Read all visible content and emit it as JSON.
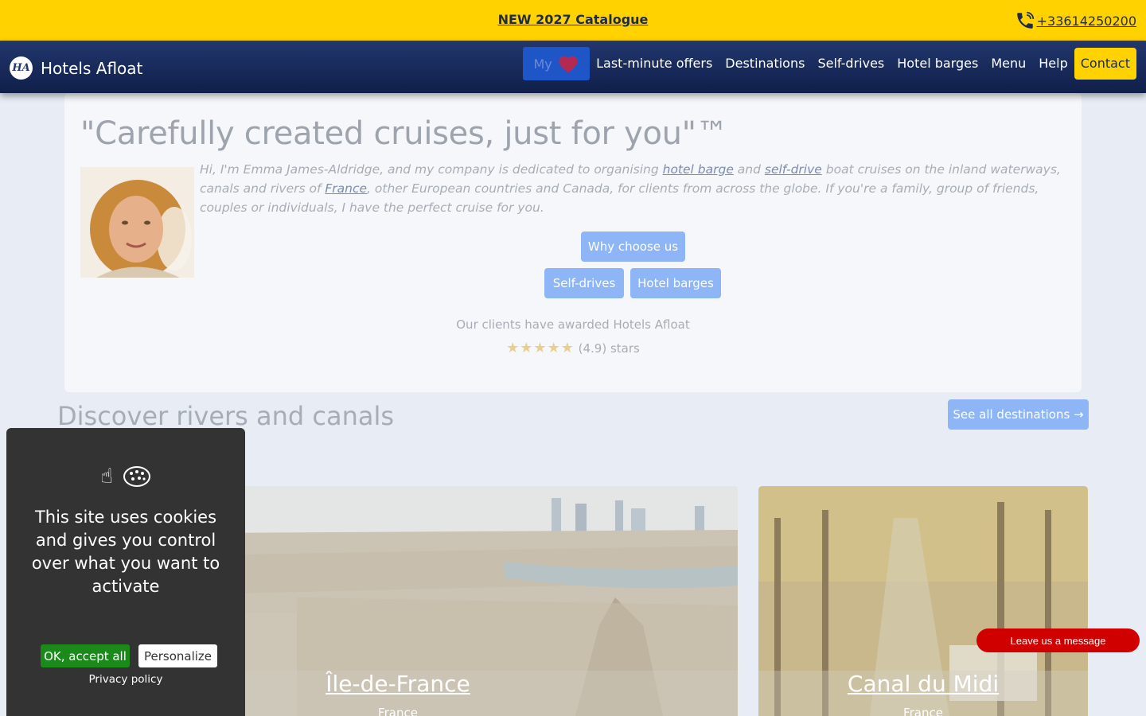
{
  "topbar": {
    "catalogue": "NEW 2027 Catalogue",
    "phone": "+33614250200"
  },
  "nav": {
    "brand": "Hotels Afloat",
    "logo_text": "HA",
    "my_label": "My",
    "links": [
      "Last-minute offers",
      "Destinations",
      "Self-drives",
      "Hotel barges",
      "Menu",
      "Help"
    ],
    "contact": "Contact"
  },
  "hero": {
    "title": "\"Carefully created cruises, just for you\"™",
    "intro_1": "Hi, I'm Emma James-Aldridge, and my company is dedicated to organising ",
    "intro_link1": "hotel barge",
    "intro_2": " and ",
    "intro_link2": "self-drive",
    "intro_3": " boat cruises on the inland waterways, canals and rivers of ",
    "intro_link3": "France",
    "intro_4": ", other European countries and Canada, for clients from across the globe. If you're a family, group of friends, couples or individuals, I have the perfect cruise for you.",
    "why_button": "Why choose us",
    "selfdrives_button": "Self-drives",
    "hotelbarges_button": "Hotel barges",
    "awarded": "Our clients have awarded Hotels Afloat",
    "stars": "★★★★★",
    "rating_text": "(4.9) stars",
    "rating_value": 4.9
  },
  "discover": {
    "title": "Discover rivers and canals",
    "see_all": "See all destinations →"
  },
  "cards": [
    {
      "title": "Île-de-France",
      "country": "France"
    },
    {
      "title": "Canal du Midi",
      "country": "France"
    }
  ],
  "cookie": {
    "message": "This site uses cookies and gives you control over what you want to activate",
    "ok": "OK, accept all",
    "personalize": "Personalize",
    "privacy": "Privacy policy",
    "icon_glyph": "☝"
  },
  "chat": {
    "leave": "Leave us a message"
  },
  "colors": {
    "yellow": "#ffd200",
    "navy": "#1d2b4f",
    "button_blue": "#8eb6f6",
    "chat_red": "#d10000"
  }
}
